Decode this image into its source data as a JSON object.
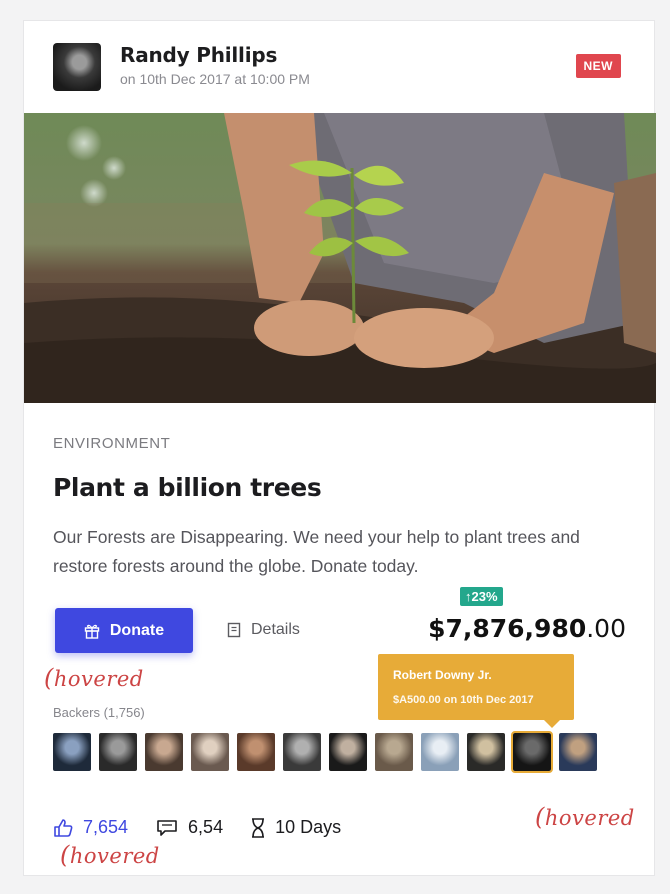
{
  "post": {
    "author": "Randy Phillips",
    "date": "on 10th Dec 2017 at 10:00 PM",
    "badge": "NEW"
  },
  "campaign": {
    "category": "ENVIRONMENT",
    "title": "Plant a billion trees",
    "description": "Our Forests are Disappearing. We need your help to plant trees and restore forests around the globe. Donate today."
  },
  "actions": {
    "donate_label": "Donate",
    "details_label": "Details"
  },
  "funding": {
    "growth": "23%",
    "amount_main": "$7,876,980",
    "amount_cents": ".00"
  },
  "tooltip": {
    "name": "Robert Downy Jr.",
    "detail": "$A500.00 on 10th Dec 2017"
  },
  "backers": {
    "label": "Backers (1,756)",
    "count": 13,
    "hovered_index": 11
  },
  "stats": {
    "likes": "7,654",
    "comments": "6,54",
    "time_left": "10 Days"
  },
  "annotations": {
    "donate_hover": "hovered",
    "backer_hover": "hovered",
    "likes_hover": "hovered"
  },
  "colors": {
    "accent": "#3f48e0",
    "badge_new": "#e0464e",
    "growth": "#23a78c",
    "tooltip": "#e7ab38",
    "annotation": "#cc4444"
  }
}
